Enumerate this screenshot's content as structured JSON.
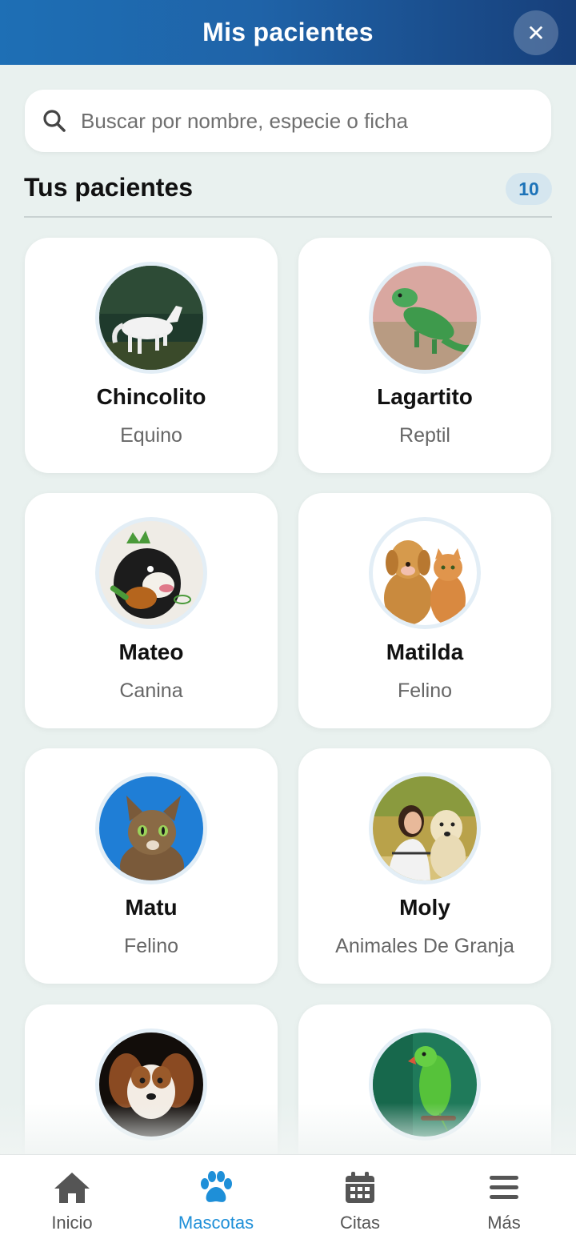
{
  "header": {
    "title": "Mis pacientes",
    "close_symbol": "✕",
    "gradient_colors": [
      "#1e6fb5",
      "#173f7a"
    ]
  },
  "search": {
    "placeholder": "Buscar por nombre, especie o ficha",
    "value": "",
    "icon": "search-icon"
  },
  "section": {
    "title": "Tus pacientes",
    "count": "10"
  },
  "patients": [
    {
      "name": "Chincolito",
      "species": "Equino",
      "photo": "horse-photo"
    },
    {
      "name": "Lagartito",
      "species": "Reptil",
      "photo": "iguana-photo"
    },
    {
      "name": "Mateo",
      "species": "Canina",
      "photo": "dog-illustration"
    },
    {
      "name": "Matilda",
      "species": "Felino",
      "photo": "dog-and-cat-photo"
    },
    {
      "name": "Matu",
      "species": "Felino",
      "photo": "cat-photo"
    },
    {
      "name": "Moly",
      "species": "Animales De Granja",
      "photo": "woman-with-dog-photo"
    },
    {
      "name": "",
      "species": "",
      "photo": "small-dog-photo"
    },
    {
      "name": "",
      "species": "",
      "photo": "parrot-photo"
    }
  ],
  "bottom_nav": {
    "items": [
      {
        "label": "Inicio",
        "icon": "home-icon"
      },
      {
        "label": "Mascotas",
        "icon": "paw-icon"
      },
      {
        "label": "Citas",
        "icon": "calendar-icon"
      },
      {
        "label": "Más",
        "icon": "menu-icon"
      }
    ],
    "active": "Mascotas",
    "active_color": "#1e8fd8",
    "inactive_color": "#555555"
  },
  "colors": {
    "background": "#e9f1ef",
    "badge_bg": "#d5e6ef",
    "badge_text": "#1d73b8"
  }
}
